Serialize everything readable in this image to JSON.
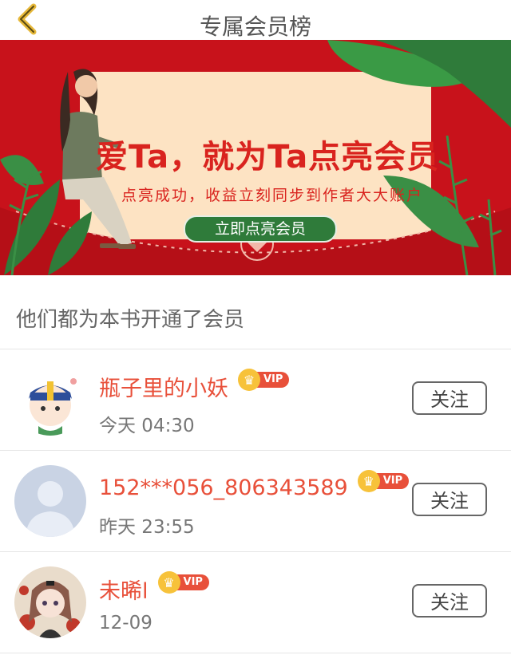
{
  "header": {
    "title": "专属会员榜"
  },
  "banner": {
    "title": "爱Ta，就为Ta点亮会员",
    "subtitle": "点亮成功，收益立刻同步到作者大大账户",
    "cta": "立即点亮会员"
  },
  "section": {
    "title": "他们都为本书开通了会员"
  },
  "members": [
    {
      "name": "瓶子里的小妖",
      "time": "今天 04:30",
      "badge": "VIP",
      "follow": "关注",
      "avatar": "cartoon-avatar"
    },
    {
      "name": "152***056_806343589",
      "time": "昨天 23:55",
      "badge": "VIP",
      "follow": "关注",
      "avatar": "default-avatar"
    },
    {
      "name": "未晞l",
      "time": "12-09",
      "badge": "VIP",
      "follow": "关注",
      "avatar": "anime-girl-avatar"
    }
  ],
  "colors": {
    "banner": "#c8121b",
    "accent": "#e8503a",
    "cta": "#2f7b3a",
    "crown": "#f7c23a"
  },
  "icons": {
    "back": "chevron-left-icon",
    "crown": "crown-icon"
  }
}
